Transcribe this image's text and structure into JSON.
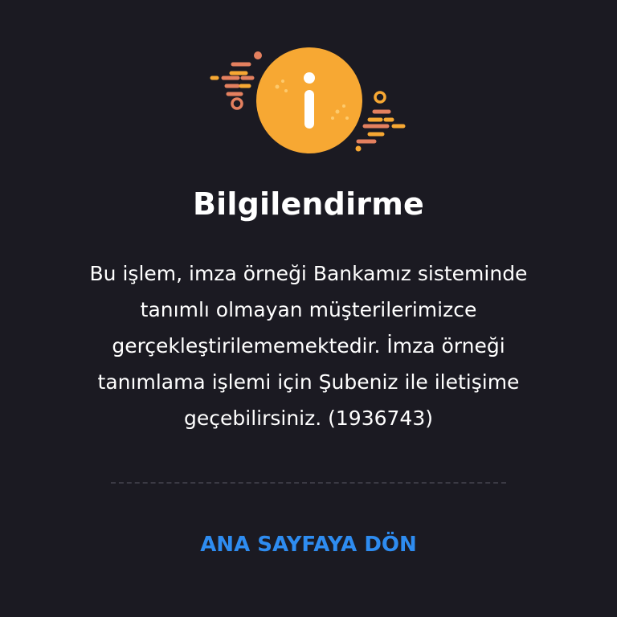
{
  "dialog": {
    "icon": "info-icon",
    "title": "Bilgilendirme",
    "message": "Bu işlem, imza örneği Bankamız sisteminde tanımlı olmayan müşterilerimizce gerçekleştirilememektedir. İmza örneği tanımlama işlemi için Şubeniz ile iletişime geçebilirsiniz. (1936743)",
    "action_label": "ANA SAYFAYA DÖN"
  },
  "colors": {
    "background": "#1b1a22",
    "accent_orange": "#f7a833",
    "decor_salmon": "#e4805f",
    "link_blue": "#2e8cf0",
    "divider": "#3b3a44"
  }
}
